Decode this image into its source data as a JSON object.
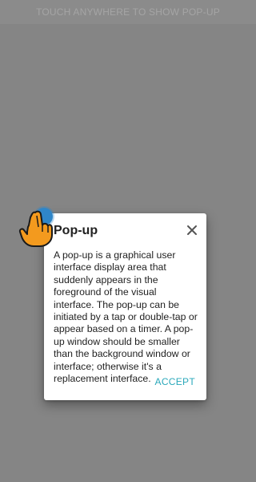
{
  "topbar": {
    "hint": "TOUCH ANYWHERE TO SHOW POP-UP"
  },
  "dialog": {
    "title": "Pop-up",
    "body": "A pop-up is a graphical user interface display area that suddenly appears in the foreground of the visual interface. The pop-up can be initiated by a tap or double-tap or appear based on a timer. A pop-up window should be smaller than the background window or interface; otherwise it's a replacement interface.",
    "accept_label": "ACCEPT",
    "close_icon": "close-icon"
  },
  "gesture": {
    "icon": "pointing-hand-icon"
  },
  "colors": {
    "accent": "#2aa8ba",
    "scrim": "#858585",
    "touch_dot": "#2f86c9",
    "hand": "#f39a1e"
  }
}
